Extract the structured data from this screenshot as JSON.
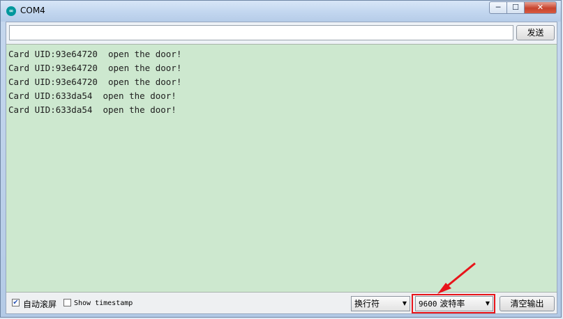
{
  "window": {
    "title": "COM4",
    "app_icon": "arduino-icon",
    "controls": {
      "minimize": "─",
      "maximize": "☐",
      "close": "✕"
    }
  },
  "send": {
    "input_value": "",
    "button_label": "发送"
  },
  "output": {
    "lines": [
      "Card UID:93e64720  open the door!",
      "Card UID:93e64720  open the door!",
      "Card UID:93e64720  open the door!",
      "Card UID:633da54  open the door!",
      "Card UID:633da54  open the door!"
    ],
    "background_color": "#cde8cf"
  },
  "footer": {
    "autoscroll": {
      "label": "自动滚屏",
      "checked": true
    },
    "timestamp": {
      "label": "Show timestamp",
      "checked": false
    },
    "line_ending": {
      "selected": "换行符"
    },
    "baud_rate": {
      "value": "9600",
      "unit": "波特率"
    },
    "clear_button": "清空输出"
  },
  "annotation": {
    "highlight_color": "#e8141a",
    "target": "baud-rate-select"
  }
}
